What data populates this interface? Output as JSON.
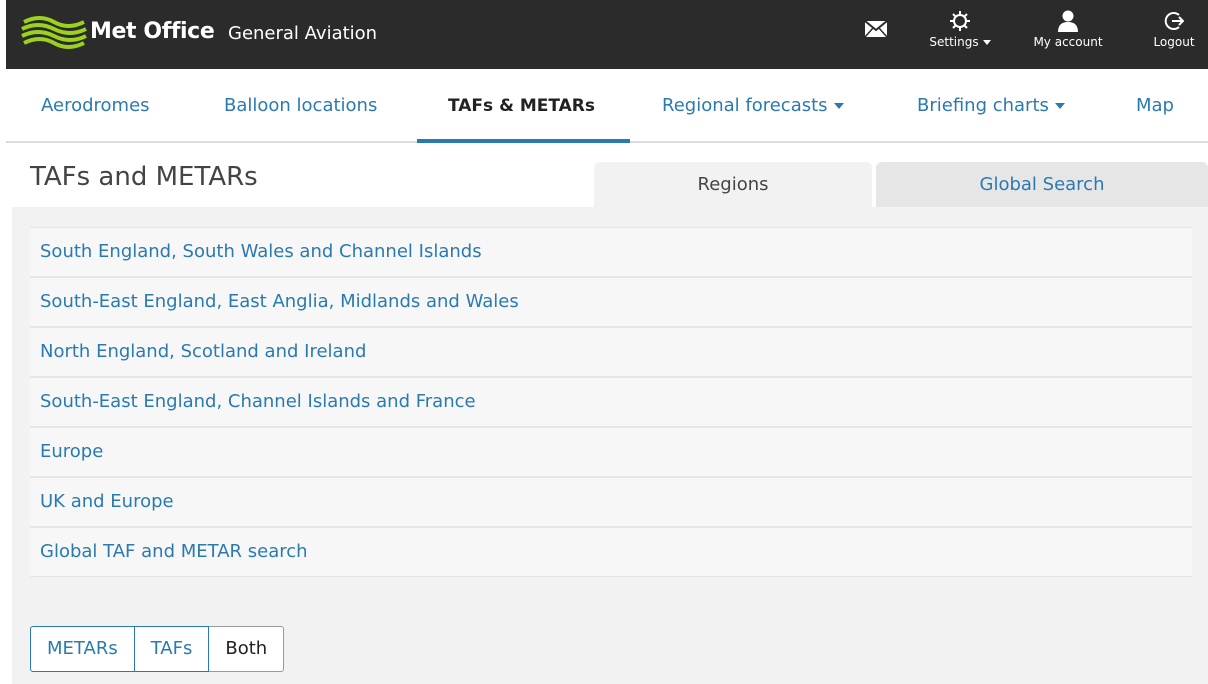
{
  "header": {
    "brand": "Met Office",
    "subbrand": "General Aviation",
    "actions": [
      {
        "label": "",
        "icon": "mail-icon"
      },
      {
        "label": "Settings",
        "icon": "gear-icon"
      },
      {
        "label": "My account",
        "icon": "user-icon"
      },
      {
        "label": "Logout",
        "icon": "logout-icon"
      }
    ]
  },
  "nav": {
    "items": [
      {
        "label": "Aerodromes"
      },
      {
        "label": "Balloon locations"
      },
      {
        "label": "TAFs & METARs",
        "active": true
      },
      {
        "label": "Regional forecasts",
        "dropdown": true
      },
      {
        "label": "Briefing charts",
        "dropdown": true
      },
      {
        "label": "Map"
      }
    ]
  },
  "page": {
    "title": "TAFs and METARs",
    "tabs": [
      {
        "label": "Regions",
        "active": true
      },
      {
        "label": "Global Search"
      }
    ]
  },
  "regions": [
    "South England, South Wales and Channel Islands",
    "South-East England, East Anglia, Midlands and Wales",
    "North England, Scotland and Ireland",
    "South-East England, Channel Islands and France",
    "Europe",
    "UK and Europe",
    "Global TAF and METAR search"
  ],
  "report_type": {
    "options": [
      "METARs",
      "TAFs",
      "Both"
    ],
    "selected": "Both"
  },
  "colors": {
    "topbar": "#2b2b2b",
    "link": "#2a7ab0",
    "logo_green": "#9bd21e",
    "panel": "#f2f2f2"
  }
}
